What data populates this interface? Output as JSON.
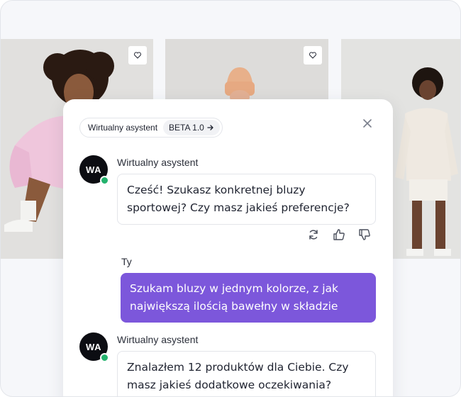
{
  "assistant": {
    "name": "Wirtualny asystent",
    "initials": "WA",
    "badge": "BETA 1.0"
  },
  "user": {
    "name": "Ty"
  },
  "messages": [
    {
      "sender": "Wirtualny asystent",
      "text": "Cześć! Szukasz konkretnej bluzy sportowej? Czy masz jakieś preferencje?"
    },
    {
      "sender": "Ty",
      "text": "Szukam bluzy w jednym kolorze, z jak największą ilością bawełny w składzie"
    },
    {
      "sender": "Wirtualny asystent",
      "text": "Znalazłem 12 produktów dla Ciebie. Czy masz jakieś dodatkowe oczekiwania?"
    }
  ],
  "colors": {
    "accent": "#7c57db",
    "online": "#23b26d",
    "avatar": "#0c0d12"
  },
  "icons": [
    "heart-icon",
    "close-icon",
    "regenerate-icon",
    "thumbs-up-icon",
    "thumbs-down-icon",
    "arrow-right-icon"
  ]
}
